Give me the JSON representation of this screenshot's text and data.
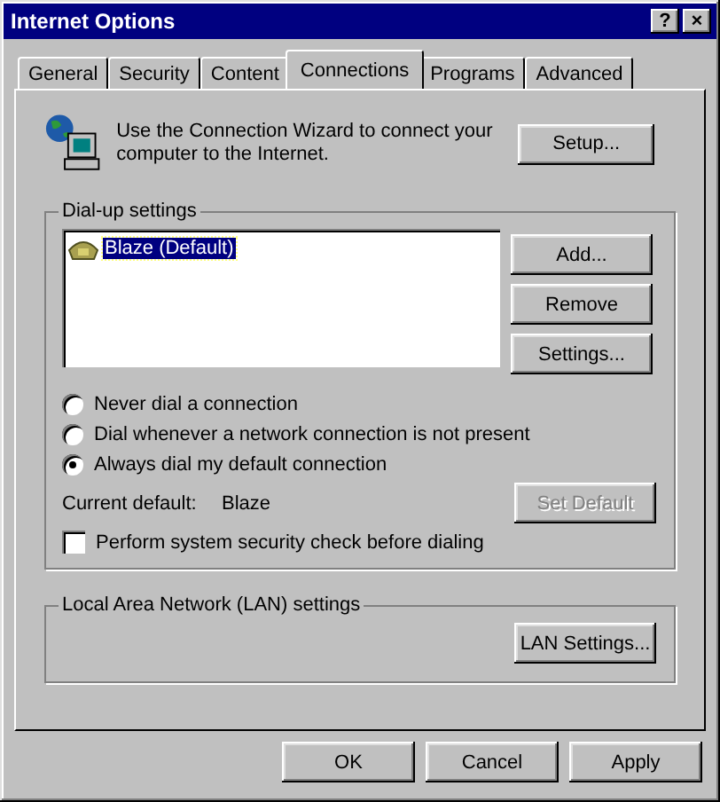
{
  "window": {
    "title": "Internet Options",
    "help_button": "?",
    "close_button": "×"
  },
  "tabs": [
    {
      "label": "General",
      "selected": false
    },
    {
      "label": "Security",
      "selected": false
    },
    {
      "label": "Content",
      "selected": false
    },
    {
      "label": "Connections",
      "selected": true
    },
    {
      "label": "Programs",
      "selected": false
    },
    {
      "label": "Advanced",
      "selected": false
    }
  ],
  "wizard": {
    "text": "Use the Connection Wizard to connect your computer to the Internet.",
    "button": "Setup..."
  },
  "dialup": {
    "title": "Dial-up settings",
    "connections": [
      {
        "name": "Blaze (Default)",
        "selected": true
      }
    ],
    "buttons": [
      {
        "label": "Add...",
        "disabled": false
      },
      {
        "label": "Remove",
        "disabled": false
      },
      {
        "label": "Settings...",
        "disabled": false
      }
    ],
    "options": [
      {
        "label": "Never dial a connection",
        "selected": false
      },
      {
        "label": "Dial whenever a network connection is not present",
        "selected": false
      },
      {
        "label": "Always dial my default connection",
        "selected": true
      }
    ],
    "current_default_label": "Current default:",
    "current_default": "Blaze",
    "set_default": {
      "label": "Set Default",
      "disabled": true
    },
    "security_check": {
      "label": "Perform system security check before dialing",
      "checked": false
    }
  },
  "lan": {
    "title": "Local Area Network (LAN) settings",
    "button": "LAN Settings..."
  },
  "buttons": [
    {
      "label": "OK"
    },
    {
      "label": "Cancel"
    },
    {
      "label": "Apply"
    }
  ]
}
